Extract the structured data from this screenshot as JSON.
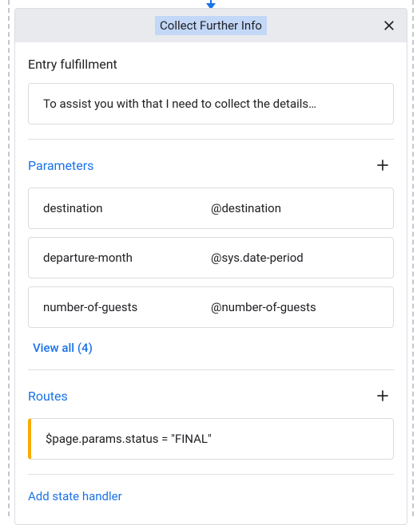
{
  "header": {
    "title": "Collect Further Info"
  },
  "entry_fulfillment": {
    "title": "Entry fulfillment",
    "message": "To assist you with that I need to collect the details…"
  },
  "parameters": {
    "title": "Parameters",
    "items": [
      {
        "name": "destination",
        "entity": "@destination"
      },
      {
        "name": "departure-month",
        "entity": "@sys.date-period"
      },
      {
        "name": "number-of-guests",
        "entity": "@number-of-guests"
      }
    ],
    "view_all_label": "View all (4)"
  },
  "routes": {
    "title": "Routes",
    "items": [
      {
        "condition": "$page.params.status = \"FINAL\""
      }
    ]
  },
  "add_state_handler_label": "Add state handler"
}
